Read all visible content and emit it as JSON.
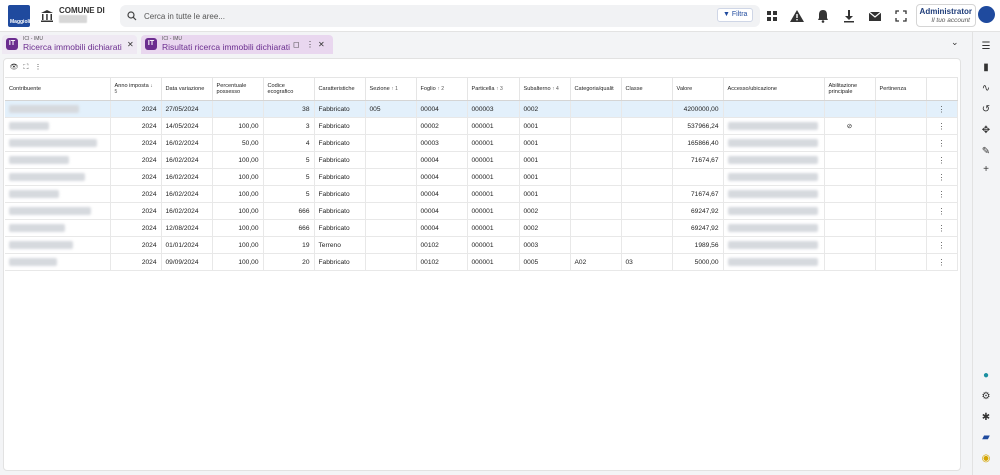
{
  "header": {
    "logo_text": "Maggioli",
    "comune_label": "COMUNE DI",
    "search_placeholder": "Cerca in tutte le aree...",
    "filter_label": "Filtra",
    "user_name": "Administrator",
    "user_sub": "Il tuo account"
  },
  "tabs": [
    {
      "small": "ICI - IMU",
      "title": "Ricerca immobili dichiarati",
      "icon": "IT"
    },
    {
      "small": "ICI - IMU",
      "title": "Risultati ricerca immobili dichiarati",
      "icon": "IT"
    }
  ],
  "table": {
    "headers": {
      "contribuente": "Contribuente",
      "anno": "Anno imposta",
      "anno_sort": "↓ 5",
      "data": "Data variazione",
      "percentuale": "Percentuale possesso",
      "codice": "Codice ecografico",
      "caratteristiche": "Caratteristiche",
      "sezione": "Sezione",
      "sezione_sort": "↑ 1",
      "foglio": "Foglio",
      "foglio_sort": "↑ 2",
      "particella": "Particella",
      "particella_sort": "↑ 3",
      "subalterno": "Subalterno",
      "subalterno_sort": "↑ 4",
      "categoria": "Categoria/qualit",
      "classe": "Classe",
      "valore": "Valore",
      "accesso": "Accesso/ubicazione",
      "abilitazione": "Abilitazione principale",
      "pertinenza": "Pertinenza"
    },
    "rows": [
      {
        "anno": "2024",
        "data": "27/05/2024",
        "perc": "",
        "codice": "38",
        "caratt": "Fabbricato",
        "sezione": "005",
        "foglio": "00004",
        "particella": "000003",
        "sub": "0002",
        "categoria": "",
        "classe": "",
        "valore": "4200000,00",
        "abil": ""
      },
      {
        "anno": "2024",
        "data": "14/05/2024",
        "perc": "100,00",
        "codice": "3",
        "caratt": "Fabbricato",
        "sezione": "",
        "foglio": "00002",
        "particella": "000001",
        "sub": "0001",
        "categoria": "",
        "classe": "",
        "valore": "537966,24",
        "abil": "⊘"
      },
      {
        "anno": "2024",
        "data": "16/02/2024",
        "perc": "50,00",
        "codice": "4",
        "caratt": "Fabbricato",
        "sezione": "",
        "foglio": "00003",
        "particella": "000001",
        "sub": "0001",
        "categoria": "",
        "classe": "",
        "valore": "165866,40",
        "abil": ""
      },
      {
        "anno": "2024",
        "data": "16/02/2024",
        "perc": "100,00",
        "codice": "5",
        "caratt": "Fabbricato",
        "sezione": "",
        "foglio": "00004",
        "particella": "000001",
        "sub": "0001",
        "categoria": "",
        "classe": "",
        "valore": "71674,67",
        "abil": ""
      },
      {
        "anno": "2024",
        "data": "16/02/2024",
        "perc": "100,00",
        "codice": "5",
        "caratt": "Fabbricato",
        "sezione": "",
        "foglio": "00004",
        "particella": "000001",
        "sub": "0001",
        "categoria": "",
        "classe": "",
        "valore": "",
        "abil": ""
      },
      {
        "anno": "2024",
        "data": "16/02/2024",
        "perc": "100,00",
        "codice": "5",
        "caratt": "Fabbricato",
        "sezione": "",
        "foglio": "00004",
        "particella": "000001",
        "sub": "0001",
        "categoria": "",
        "classe": "",
        "valore": "71674,67",
        "abil": ""
      },
      {
        "anno": "2024",
        "data": "16/02/2024",
        "perc": "100,00",
        "codice": "666",
        "caratt": "Fabbricato",
        "sezione": "",
        "foglio": "00004",
        "particella": "000001",
        "sub": "0002",
        "categoria": "",
        "classe": "",
        "valore": "69247,92",
        "abil": ""
      },
      {
        "anno": "2024",
        "data": "12/08/2024",
        "perc": "100,00",
        "codice": "666",
        "caratt": "Fabbricato",
        "sezione": "",
        "foglio": "00004",
        "particella": "000001",
        "sub": "0002",
        "categoria": "",
        "classe": "",
        "valore": "69247,92",
        "abil": ""
      },
      {
        "anno": "2024",
        "data": "01/01/2024",
        "perc": "100,00",
        "codice": "19",
        "caratt": "Terreno",
        "sezione": "",
        "foglio": "00102",
        "particella": "000001",
        "sub": "0003",
        "categoria": "",
        "classe": "",
        "valore": "1989,56",
        "abil": ""
      },
      {
        "anno": "2024",
        "data": "09/09/2024",
        "perc": "100,00",
        "codice": "20",
        "caratt": "Fabbricato",
        "sezione": "",
        "foglio": "00102",
        "particella": "000001",
        "sub": "0005",
        "categoria": "A02",
        "classe": "03",
        "valore": "5000,00",
        "abil": ""
      }
    ]
  },
  "icons": {
    "topbar": [
      "apps-icon",
      "warning-icon",
      "bell-icon",
      "download-icon",
      "mail-icon",
      "fullscreen-icon"
    ],
    "rail_top": [
      "list-icon",
      "book-icon",
      "chart-icon",
      "history-icon",
      "puzzle-icon",
      "edit-icon",
      "plus-icon"
    ],
    "rail_bottom": [
      "location-icon",
      "settings-icon",
      "accessibility-icon",
      "chat-icon",
      "support-icon"
    ]
  },
  "colors": {
    "brand": "#1f4a9e",
    "tab_accent": "#6b2d8f",
    "selected_row": "#e3f0fb"
  }
}
